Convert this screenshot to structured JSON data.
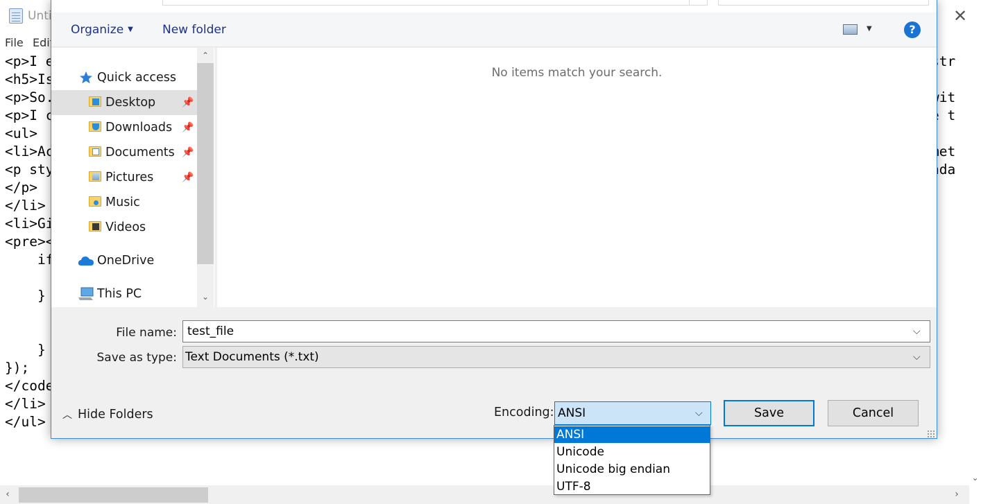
{
  "notepad": {
    "title": "Unti",
    "menu": [
      "File",
      "Edit"
    ],
    "lines": [
      "<p>I e",
      "<h5>Is",
      "<p>So.",
      "<p>I c",
      "<ul>",
      "<li>Ac",
      "<p sty",
      "</p>",
      "</li>",
      "<li>Gi",
      "<pre><",
      "    if",
      "",
      "    }",
      "",
      "",
      "    }",
      "});",
      "</code",
      "</li>",
      "</ul>"
    ],
    "right_fragments": [
      "str",
      "",
      "wit",
      "e t",
      "",
      "met",
      "ada"
    ],
    "close_glyph": "✕"
  },
  "dialog": {
    "toolbar": {
      "organize_label": "Organize",
      "new_folder_label": "New folder",
      "help_glyph": "?"
    },
    "nav": [
      {
        "label": "Quick access",
        "icon": "star-icon"
      },
      {
        "label": "Desktop",
        "icon": "desktop-folder-icon",
        "pinned": true,
        "selected": true
      },
      {
        "label": "Downloads",
        "icon": "downloads-folder-icon",
        "pinned": true
      },
      {
        "label": "Documents",
        "icon": "documents-folder-icon",
        "pinned": true
      },
      {
        "label": "Pictures",
        "icon": "pictures-folder-icon",
        "pinned": true
      },
      {
        "label": "Music",
        "icon": "music-folder-icon"
      },
      {
        "label": "Videos",
        "icon": "videos-folder-icon"
      },
      {
        "label": "OneDrive",
        "icon": "cloud-icon"
      },
      {
        "label": "This PC",
        "icon": "computer-icon"
      }
    ],
    "empty_message": "No items match your search.",
    "file_name_label": "File name:",
    "file_name_value": "test_file",
    "save_type_label": "Save as type:",
    "save_type_value": "Text Documents (*.txt)",
    "hide_folders_label": "Hide Folders",
    "encoding_label": "Encoding:",
    "encoding_value": "ANSI",
    "encoding_options": [
      "ANSI",
      "Unicode",
      "Unicode big endian",
      "UTF-8"
    ],
    "save_label": "Save",
    "cancel_label": "Cancel"
  },
  "colors": {
    "accent": "#0078d7",
    "link_text": "#1e3287",
    "help": "#1a73d0"
  }
}
